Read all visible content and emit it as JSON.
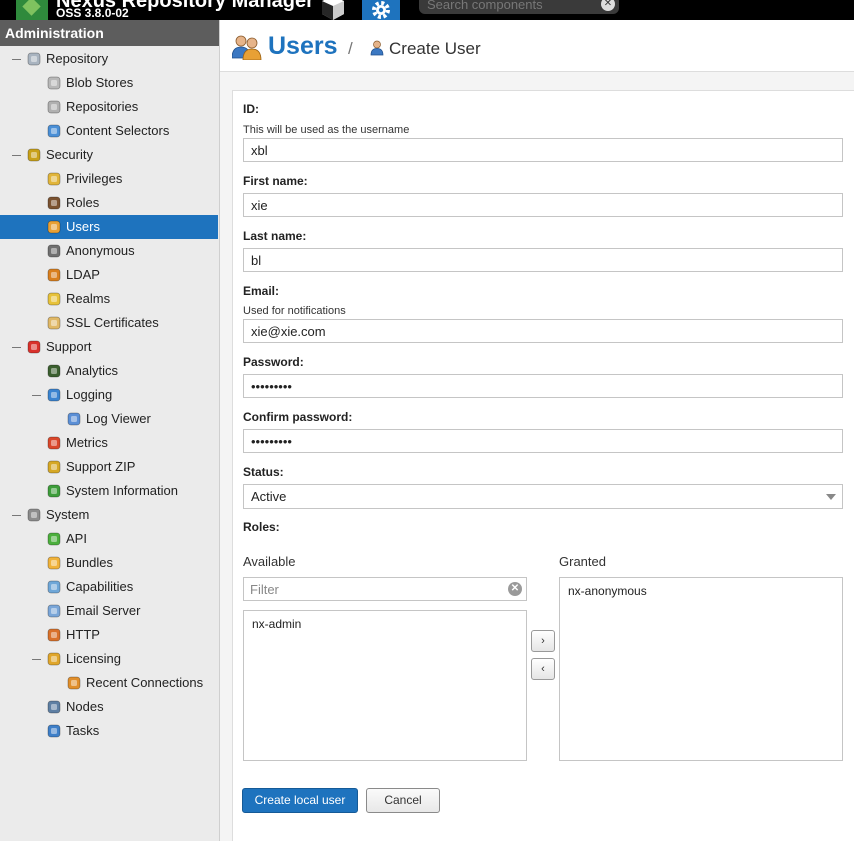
{
  "header": {
    "app_title": "Nexus Repository Manager",
    "version": "OSS 3.8.0-02",
    "search_placeholder": "Search components"
  },
  "sidebar": {
    "title": "Administration",
    "items": [
      {
        "label": "Repository",
        "icon": "database-icon"
      },
      {
        "label": "Blob Stores",
        "icon": "blob-store-icon"
      },
      {
        "label": "Repositories",
        "icon": "repository-icon"
      },
      {
        "label": "Content Selectors",
        "icon": "content-selector-icon"
      },
      {
        "label": "Security",
        "icon": "security-badge-icon"
      },
      {
        "label": "Privileges",
        "icon": "medal-icon"
      },
      {
        "label": "Roles",
        "icon": "role-icon"
      },
      {
        "label": "Users",
        "icon": "users-icon",
        "selected": true
      },
      {
        "label": "Anonymous",
        "icon": "anonymous-user-icon"
      },
      {
        "label": "LDAP",
        "icon": "address-book-icon"
      },
      {
        "label": "Realms",
        "icon": "shield-icon"
      },
      {
        "label": "SSL Certificates",
        "icon": "certificate-icon"
      },
      {
        "label": "Support",
        "icon": "lifebuoy-icon"
      },
      {
        "label": "Analytics",
        "icon": "chart-icon"
      },
      {
        "label": "Logging",
        "icon": "book-icon"
      },
      {
        "label": "Log Viewer",
        "icon": "log-viewer-icon"
      },
      {
        "label": "Metrics",
        "icon": "pie-icon"
      },
      {
        "label": "Support ZIP",
        "icon": "zip-icon"
      },
      {
        "label": "System Information",
        "icon": "globe-icon"
      },
      {
        "label": "System",
        "icon": "gear-icon"
      },
      {
        "label": "API",
        "icon": "api-icon"
      },
      {
        "label": "Bundles",
        "icon": "puzzle-icon"
      },
      {
        "label": "Capabilities",
        "icon": "box-icon"
      },
      {
        "label": "Email Server",
        "icon": "envelope-icon"
      },
      {
        "label": "HTTP",
        "icon": "truck-icon"
      },
      {
        "label": "Licensing",
        "icon": "license-icon"
      },
      {
        "label": "Recent Connections",
        "icon": "connections-icon"
      },
      {
        "label": "Nodes",
        "icon": "nodes-icon"
      },
      {
        "label": "Tasks",
        "icon": "clock-icon"
      }
    ]
  },
  "page": {
    "title": "Users",
    "separator": "/",
    "breadcrumb": "Create User"
  },
  "form": {
    "id_label": "ID:",
    "id_help": "This will be used as the username",
    "id_value": "xbl",
    "first_name_label": "First name:",
    "first_name_value": "xie",
    "last_name_label": "Last name:",
    "last_name_value": "bl",
    "email_label": "Email:",
    "email_help": "Used for notifications",
    "email_value": "xie@xie.com",
    "password_label": "Password:",
    "password_value": "•••••••••",
    "confirm_label": "Confirm password:",
    "confirm_value": "•••••••••",
    "status_label": "Status:",
    "status_value": "Active",
    "roles_label": "Roles:",
    "available_label": "Available",
    "granted_label": "Granted",
    "filter_placeholder": "Filter",
    "available_roles": [
      "nx-admin"
    ],
    "granted_roles": [
      "nx-anonymous"
    ],
    "add_symbol": "›",
    "remove_symbol": "‹",
    "create_label": "Create local user",
    "cancel_label": "Cancel"
  },
  "colors": {
    "accent": "#1e73be",
    "sidebar_header": "#5d5d5d",
    "topbar": "#000000"
  }
}
